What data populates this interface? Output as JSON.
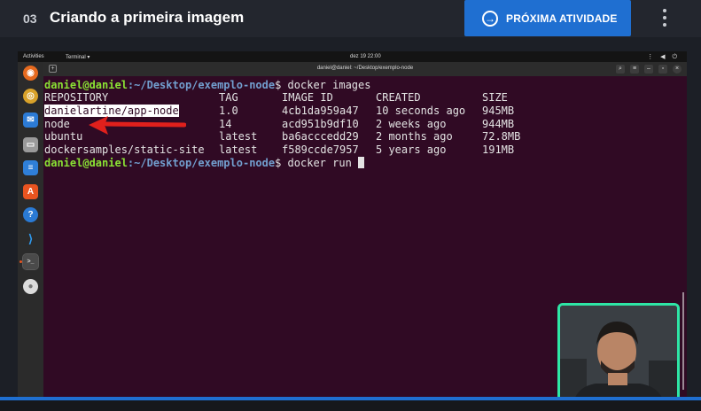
{
  "header": {
    "lesson_number": "03",
    "lesson_title": "Criando a primeira imagem",
    "next_label": "PRÓXIMA ATIVIDADE"
  },
  "gnome": {
    "activities": "Activities",
    "app_menu": "Terminal ▾",
    "clock": "dez 19  22:00",
    "tray": "⋮ ◀ ⏻"
  },
  "terminal": {
    "title": "daniel@daniel: ~/Desktop/exemplo-node",
    "prompt_user": "daniel@daniel",
    "prompt_path": ":~/Desktop/exemplo-node",
    "prompt_symbol": "$ ",
    "command1": "docker images",
    "command2": "docker run ",
    "table": {
      "headers": [
        "REPOSITORY",
        "TAG",
        "IMAGE ID",
        "CREATED",
        "SIZE"
      ],
      "rows": [
        [
          "danielartine/app-node",
          "1.0",
          "4cb1da959a47",
          "10 seconds ago",
          "945MB"
        ],
        [
          "node",
          "14",
          "acd951b9df10",
          "2 weeks ago",
          "944MB"
        ],
        [
          "ubuntu",
          "latest",
          "ba6acccedd29",
          "2 months ago",
          "72.8MB"
        ],
        [
          "dockersamples/static-site",
          "latest",
          "f589ccde7957",
          "5 years ago",
          "191MB"
        ]
      ]
    }
  },
  "dock": [
    "firefox-icon",
    "rhythmbox-icon",
    "thunderbird-icon",
    "files-icon",
    "writer-icon",
    "software-icon",
    "help-icon",
    "vscode-icon",
    "terminal-icon",
    "disc-icon"
  ],
  "colors": {
    "accent": "#1f6fd1",
    "terminal_bg": "#300a24",
    "prompt_user": "#8ae234",
    "prompt_path": "#729fcf",
    "webcam_border": "#2ee6a6",
    "arrow": "#e0201c"
  }
}
